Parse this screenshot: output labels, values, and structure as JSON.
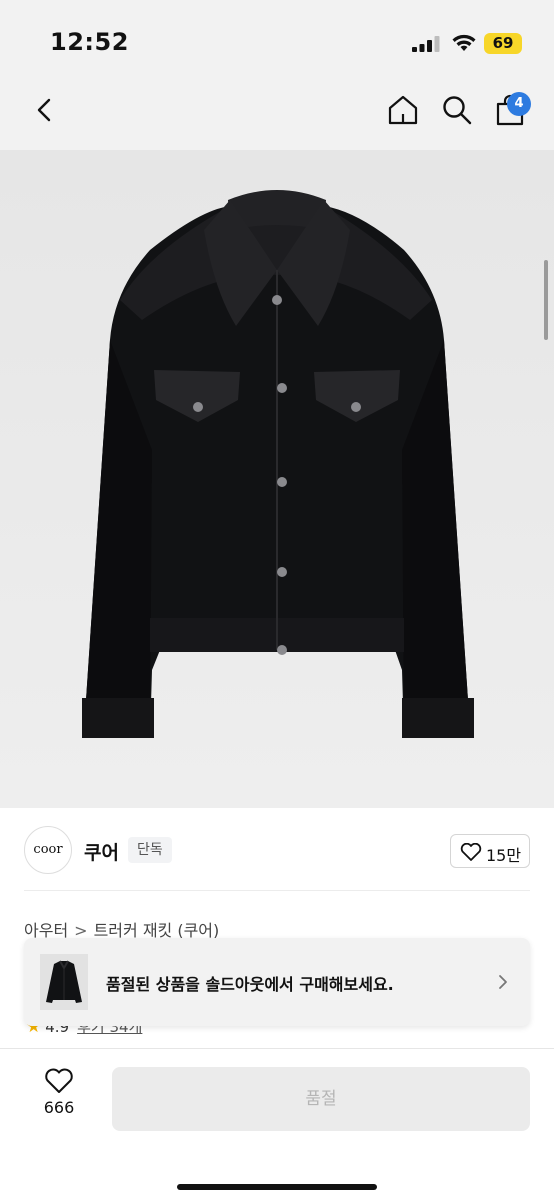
{
  "status_bar": {
    "time": "12:52",
    "battery": "69"
  },
  "nav": {
    "cart_count": "4"
  },
  "brand": {
    "logo_text": "coor",
    "name": "쿠어",
    "badge": "단독",
    "like_count": "15만"
  },
  "breadcrumb": {
    "category": "아우터",
    "separator": ">",
    "product": "트러커 재킷 (쿠어)"
  },
  "rating": {
    "score": "4.9",
    "reviews": "후기 34개"
  },
  "banner": {
    "text": "품절된 상품을 솔드아웃에서 구매해보세요."
  },
  "bottom_bar": {
    "wish_count": "666",
    "button_label": "품절"
  },
  "colors": {
    "accent_badge": "#2d7be0",
    "battery": "#f7d629",
    "star": "#f5b400"
  },
  "icons": [
    "back-icon",
    "home-icon",
    "search-icon",
    "shopping-bag-icon",
    "heart-icon",
    "chevron-right-icon",
    "star-icon"
  ]
}
